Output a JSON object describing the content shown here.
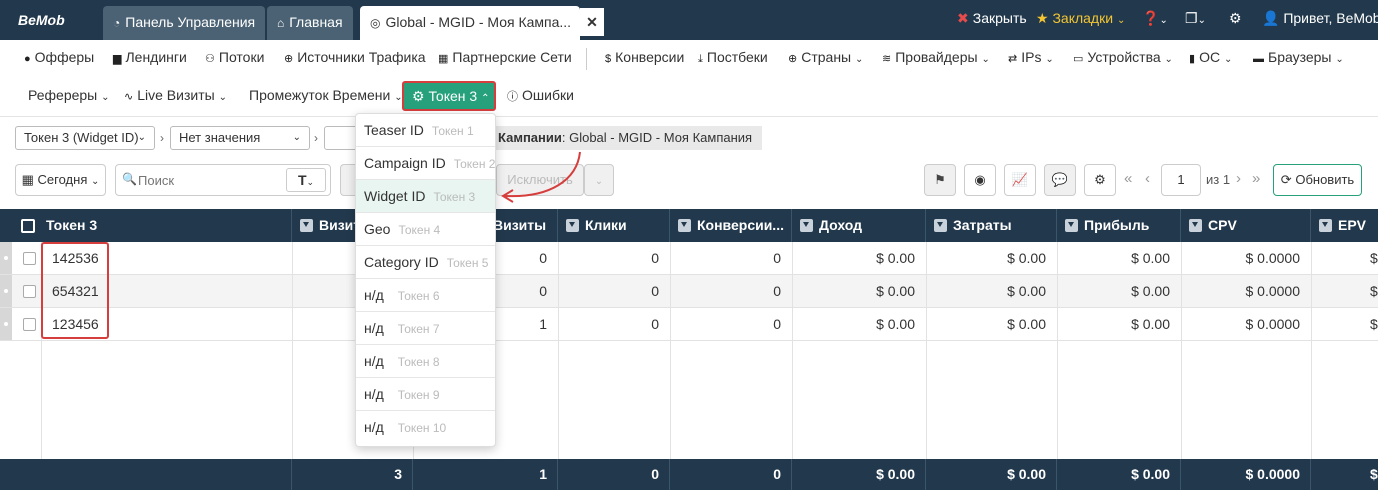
{
  "app": {
    "logo": "BeMob",
    "tabs": [
      "Панель Управления",
      "Главная",
      "Global - MGID - Моя Кампа..."
    ],
    "close_tab": "✕",
    "top_right": {
      "close": "Закрыть",
      "bookmarks": "Закладки",
      "greeting": "Привет, BeMob"
    }
  },
  "nav1": [
    "Офферы",
    "Лендинги",
    "Потоки",
    "Источники Трафика",
    "Партнерские Сети",
    "Конверсии",
    "Постбеки",
    "Страны",
    "Провайдеры",
    "IPs",
    "Устройства",
    "ОС",
    "Браузеры"
  ],
  "nav2": [
    "Рефереры",
    "Live Визиты",
    "Промежуток Времени",
    "Токен 3",
    "Ошибки"
  ],
  "breadcrumb": {
    "select1": "Токен 3 (Widget ID)",
    "select2": "Нет значения",
    "campaign_label": "Кампании",
    "campaign_value": "Global - MGID - Моя Кампания"
  },
  "toolbar": {
    "date": "Сегодня",
    "search_placeholder": "Поиск",
    "text_btn": "T",
    "exclude": "Исключить",
    "page": "1",
    "page_of": "из 1",
    "refresh": "Обновить"
  },
  "dropdown": [
    {
      "label": "Teaser ID",
      "token": "Токен 1"
    },
    {
      "label": "Campaign ID",
      "token": "Токен 2"
    },
    {
      "label": "Widget ID",
      "token": "Токен 3"
    },
    {
      "label": "Geo",
      "token": "Токен 4"
    },
    {
      "label": "Category ID",
      "token": "Токен 5"
    },
    {
      "label": "н/д",
      "token": "Токен 6"
    },
    {
      "label": "н/д",
      "token": "Токен 7"
    },
    {
      "label": "н/д",
      "token": "Токен 8"
    },
    {
      "label": "н/д",
      "token": "Токен 9"
    },
    {
      "label": "н/д",
      "token": "Токен 10"
    }
  ],
  "table": {
    "columns": [
      "Токен 3",
      "Визиты",
      "Визиты",
      "Клики",
      "Конверсии...",
      "Доход",
      "Затраты",
      "Прибыль",
      "CPV",
      "EPV"
    ],
    "rows": [
      [
        "142536",
        "0",
        "0",
        "0",
        "$ 0.00",
        "$ 0.00",
        "$ 0.00",
        "$ 0.0000",
        "$"
      ],
      [
        "654321",
        "0",
        "0",
        "0",
        "$ 0.00",
        "$ 0.00",
        "$ 0.00",
        "$ 0.0000",
        "$"
      ],
      [
        "123456",
        "1",
        "0",
        "0",
        "$ 0.00",
        "$ 0.00",
        "$ 0.00",
        "$ 0.0000",
        "$"
      ]
    ],
    "totals": [
      "3",
      "1",
      "0",
      "0",
      "$ 0.00",
      "$ 0.00",
      "$ 0.00",
      "$ 0.0000",
      "$"
    ]
  }
}
